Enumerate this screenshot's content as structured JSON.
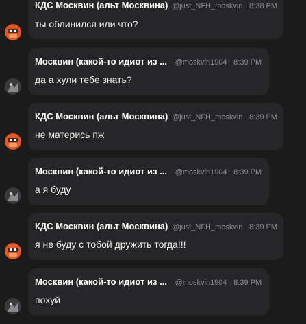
{
  "messages": [
    {
      "author": "КДС Москвин (альт Москвина)",
      "handle": "@just_NFH_moskvin",
      "time": "8:38 PM",
      "text": "ты облинился или что?",
      "avatar": "orange-avatar-icon"
    },
    {
      "author": "Москвин (какой-то идиот из ...",
      "handle": "@moskvin1904",
      "time": "8:39 PM",
      "text": "да а хули тебе знать?",
      "avatar": "dark-avatar-icon"
    },
    {
      "author": "КДС Москвин (альт Москвина)",
      "handle": "@just_NFH_moskvin",
      "time": "8:39 PM",
      "text": "не матерись пж",
      "avatar": "orange-avatar-icon"
    },
    {
      "author": "Москвин (какой-то идиот из ...",
      "handle": "@moskvin1904",
      "time": "8:39 PM",
      "text": "а я буду",
      "avatar": "dark-avatar-icon"
    },
    {
      "author": "КДС Москвин (альт Москвина)",
      "handle": "@just_NFH_moskvin",
      "time": "8:39 PM",
      "text": "я не буду с тобой дружить тогда!!!",
      "avatar": "orange-avatar-icon"
    },
    {
      "author": "Москвин (какой-то идиот из ...",
      "handle": "@moskvin1904",
      "time": "8:39 PM",
      "text": "похуй",
      "avatar": "dark-avatar-icon"
    }
  ],
  "colors": {
    "background": "#1b1b1c",
    "bubble": "#262628",
    "meta": "#8e8e93",
    "orange_avatar": "#e8561f"
  }
}
